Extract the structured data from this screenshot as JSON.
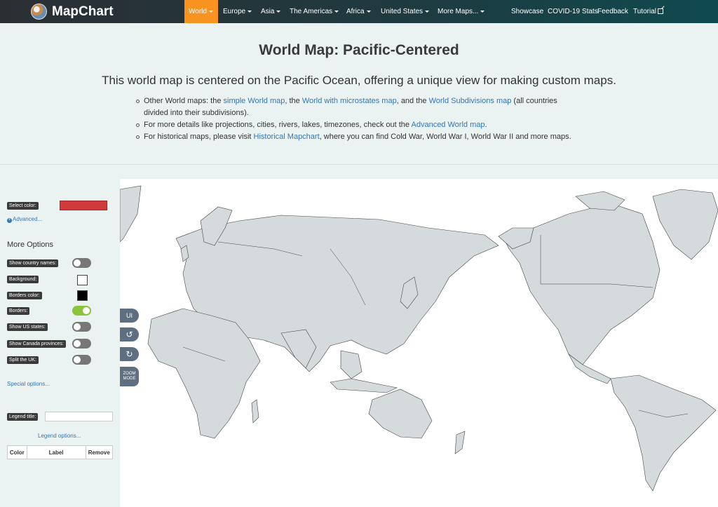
{
  "brand": {
    "name": "MapChart"
  },
  "nav": {
    "items": [
      "World",
      "Europe",
      "Asia",
      "The Americas",
      "Africa",
      "United States",
      "More Maps..."
    ],
    "right_items": [
      "Showcase",
      "COVID-19 Stats",
      "Feedback",
      "Tutorial"
    ]
  },
  "page": {
    "title": "World Map: Pacific-Centered",
    "subtitle": "This world map is centered on the Pacific Ocean, offering a unique view for making custom maps.",
    "bullets": {
      "b1_pre": "Other World maps: the ",
      "b1_link1": "simple World map",
      "b1_mid1": ", the ",
      "b1_link2": "World with microstates map",
      "b1_mid2": ", and the ",
      "b1_link3": "World Subdivisions map",
      "b1_post": " (all countries divided into their subdivisions).",
      "b2_pre": "For more details like projections, cities, rivers, lakes, timezones, check out the ",
      "b2_link": "Advanced World map",
      "b2_post": ".",
      "b3_pre": "For historical maps, please visit ",
      "b3_link": "Historical Mapchart",
      "b3_post": ", where you can find Cold War, World War I, World War II and more maps."
    }
  },
  "sidebar": {
    "select_color_label": "Select color:",
    "selected_color": "#d13a3a",
    "advanced_link": "Advanced...",
    "more_options_title": "More Options",
    "show_country_names": "Show country names:",
    "background": "Background:",
    "borders_color": "Borders color:",
    "borders": "Borders:",
    "show_us_states": "Show US states:",
    "show_canada_provinces": "Show Canada provinces:",
    "split_uk": "Split the UK:",
    "special_options": "Special options...",
    "legend_title_label": "Legend title:",
    "legend_options": "Legend options...",
    "legend_cols": [
      "Color",
      "Label",
      "Remove"
    ]
  },
  "map_tools": {
    "ui": "UI",
    "zoom_line1": "ZOOM",
    "zoom_line2": "MODE"
  },
  "colors": {
    "accent": "#f7931e",
    "link": "#3277b6",
    "land": "#d5dadc",
    "toggle_on": "#8cc43c"
  }
}
